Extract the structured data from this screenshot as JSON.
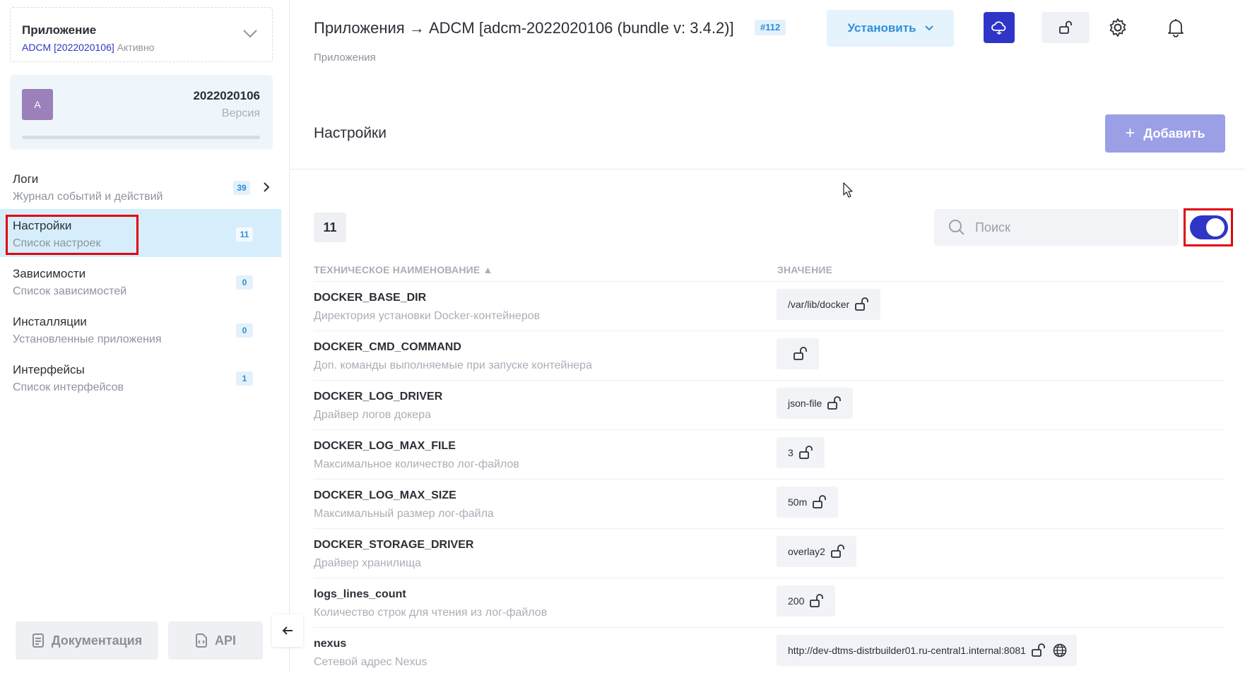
{
  "app_select": {
    "title": "Приложение",
    "name": "ADCM [2022020106]",
    "status": "Активно"
  },
  "version_card": {
    "avatar": "A",
    "number": "2022020106",
    "label": "Версия"
  },
  "nav": [
    {
      "title": "Логи",
      "subtitle": "Журнал событий и действий",
      "badge": "39"
    },
    {
      "title": "Настройки",
      "subtitle": "Список настроек",
      "badge": "11"
    },
    {
      "title": "Зависимости",
      "subtitle": "Список зависимостей",
      "badge": "0"
    },
    {
      "title": "Инсталляции",
      "subtitle": "Установленные приложения",
      "badge": "0"
    },
    {
      "title": "Интерфейсы",
      "subtitle": "Список интерфейсов",
      "badge": "1"
    }
  ],
  "footer": {
    "docs_label": "Документация",
    "api_label": "API"
  },
  "header": {
    "title": "Приложения → ADCM [adcm-2022020106 (bundle v: 3.4.2)]",
    "job_badge": "#112",
    "breadcrumb": "Приложения",
    "install_label": "Установить"
  },
  "settings": {
    "title": "Настройки",
    "add_label": "Добавить",
    "count": "11",
    "search_placeholder": "Поиск",
    "toggle_on": true,
    "col_name": "ТЕХНИЧЕСКОЕ НАИМЕНОВАНИЕ ▲",
    "col_value": "ЗНАЧЕНИЕ",
    "rows": [
      {
        "name": "DOCKER_BASE_DIR",
        "desc": "Директория установки Docker-контейнеров",
        "value": "/var/lib/docker"
      },
      {
        "name": "DOCKER_CMD_COMMAND",
        "desc": "Доп. команды выполняемые при запуске контейнера",
        "value": ""
      },
      {
        "name": "DOCKER_LOG_DRIVER",
        "desc": "Драйвер логов докера",
        "value": "json-file"
      },
      {
        "name": "DOCKER_LOG_MAX_FILE",
        "desc": "Максимальное количество лог-файлов",
        "value": "3"
      },
      {
        "name": "DOCKER_LOG_MAX_SIZE",
        "desc": "Максимальный размер лог-файла",
        "value": "50m"
      },
      {
        "name": "DOCKER_STORAGE_DRIVER",
        "desc": "Драйвер хранилища",
        "value": "overlay2"
      },
      {
        "name": "logs_lines_count",
        "desc": "Количество строк для чтения из лог-файлов",
        "value": "200"
      },
      {
        "name": "nexus",
        "desc": "Сетевой адрес Nexus",
        "value": "http://dev-dtms-distrbuilder01.ru-central1.internal:8081"
      }
    ]
  },
  "colors": {
    "accent": "#2f35c7",
    "info": "#2f8fd8",
    "highlight": "#e3000f",
    "active_nav": "#d6eefb"
  }
}
